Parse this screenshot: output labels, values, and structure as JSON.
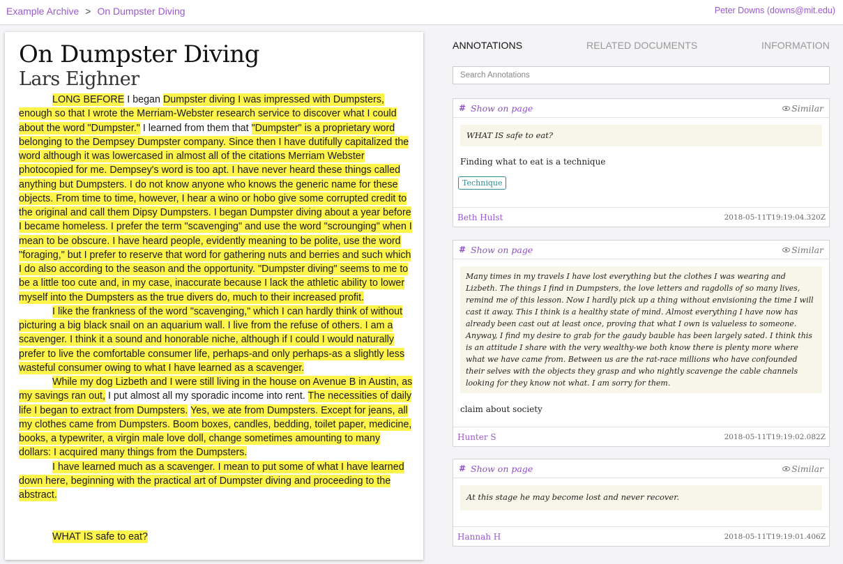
{
  "breadcrumb": {
    "root": "Example Archive",
    "separator": ">",
    "current": "On Dumpster Diving"
  },
  "user": "Peter Downs (downs@mit.edu)",
  "document": {
    "title": "On Dumpster Diving",
    "author": "Lars Eighner",
    "p1": {
      "a": "LONG BEFORE",
      "b": " I began ",
      "c": "Dumpster diving",
      "d": " I was impressed with Dumpsters, enough so that I wrote the Merriam-Webster research service to discover what I could about the word \"Dumpster.\"",
      "e": " I learned from them that ",
      "f": "\"Dumpster\" is a proprietary word belonging to the Dempsey Dumpster company. Since then I have dutifully capitalized the word although it was lowercased in almost all of the citations Merriam Webster photocopied for me.",
      "g": " Dempsey's word is too apt. I have never heard these things called anything but Dumpsters. I do not know anyone who knows the generic name for these objects. From time to time, however, I hear a wino or hobo give some corrupted credit to the original and call them Dipsy Dumpsters. ",
      "h": "I began Dumpster diving about a year before I became homeless. I prefer the term \"scavenging\" and use the word \"scrounging\" when I mean to be obscure. I have heard people, evidently meaning to be polite, use the word \"foraging,\" but I prefer to reserve that word for gathering nuts and berries and such which I do also according to the season and the opportunity. \"Dumpster diving\" seems to me to be a little too cute and, in my case, inaccurate because I lack the athletic ability to lower myself into the Dumpsters as the true divers do, much to their increased profit."
    },
    "p2": "I like the frankness of the word \"scavenging,\" which I can hardly think of without picturing a big black snail on an aquarium wall. I live from the refuse of others. I am a scavenger. I think it a sound and honorable niche, although if I could I would naturally prefer to live the comfortable consumer life, perhaps-and only perhaps-as a slightly less wasteful consumer owing to what I have learned as a scavenger.",
    "p3": {
      "a": "While my dog Lizbeth and I were still living in the house on Avenue B in Austin, as my savings ran out,",
      "b": " I put almost all my sporadic income into rent. ",
      "c": "The necessities of daily life I began to extract from Dumpsters.",
      "d": " ",
      "e": "Yes, we ate from Dumpsters. Except for jeans, all my clothes came from Dumpsters. Boom boxes, candles, bedding, toilet paper, medicine, books, a typewriter, a virgin male love doll, change sometimes amounting to many dollars: I acquired many things from the Dumpsters."
    },
    "p4": "I have learned much as a scavenger. I mean to put some of what I have learned down here, beginning with the practical art of Dumpster diving and proceeding to the abstract.",
    "p5": "WHAT IS safe to eat?"
  },
  "sidebar": {
    "tabs": [
      {
        "label": "ANNOTATIONS",
        "active": true
      },
      {
        "label": "RELATED DOCUMENTS",
        "active": false
      },
      {
        "label": "INFORMATION",
        "active": false
      }
    ],
    "search_placeholder": "Search Annotations",
    "show_label": "Show on page",
    "similar_label": "Similar",
    "annotations": [
      {
        "quote": "WHAT IS safe to eat?",
        "comment": "Finding what to eat is a technique",
        "tag": "Technique",
        "author": "Beth Hulst",
        "timestamp": "2018-05-11T19:19:04.320Z"
      },
      {
        "quote": "Many times in my travels I have lost everything but the clothes I was wearing and Lizbeth. The things I find in Dumpsters, the love letters and ragdolls of so many lives, remind me of this lesson. Now I hardly pick up a thing without envisioning the time I will cast it away. This I think is a healthy state of mind. Almost everything I have now has already been cast out at least once, proving that what I own is valueless to someone. Anyway, I find my desire to grab for the gaudy bauble has been largely sated. I think this is an attitude I share with the very wealthy-we both know there is plenty more where what we have came from. Between us are the rat-race millions who have confounded their selves with the objects they grasp and who nightly scavenge the cable channels looking for they know not what. I am sorry for them.",
        "comment": "claim about society",
        "author": "Hunter S",
        "timestamp": "2018-05-11T19:19:02.082Z"
      },
      {
        "quote": "At this stage he may become lost and never recover.",
        "author": "Hannah H",
        "timestamp": "2018-05-11T19:19:01.406Z"
      }
    ]
  },
  "colors": {
    "accent": "#9b59d0",
    "highlight": "#fff44a",
    "tag": "#2f8a93",
    "quote_bg": "#f7f6e8"
  }
}
